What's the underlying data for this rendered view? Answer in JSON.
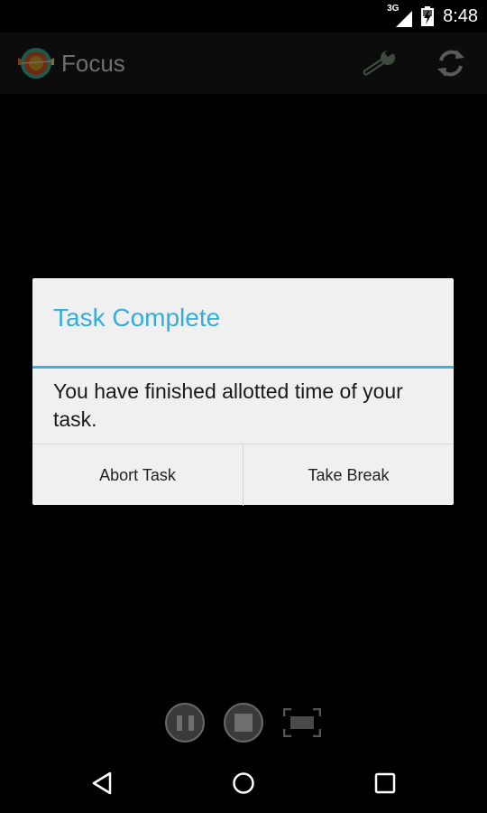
{
  "status_bar": {
    "network": "3G",
    "time": "8:48",
    "icons": [
      "signal-icon",
      "battery-charging-icon"
    ]
  },
  "action_bar": {
    "app_title": "Focus",
    "logo": "target-logo-icon",
    "actions": [
      {
        "name": "settings",
        "icon": "wrench-icon"
      },
      {
        "name": "refresh",
        "icon": "refresh-icon"
      }
    ]
  },
  "dialog": {
    "title": "Task Complete",
    "message": "You have finished allotted time of your task.",
    "buttons": [
      {
        "label": "Abort Task"
      },
      {
        "label": "Take Break"
      }
    ],
    "accent_color": "#33b5e5"
  },
  "controls": {
    "items": [
      {
        "name": "pause",
        "icon": "pause-icon"
      },
      {
        "name": "stop",
        "icon": "stop-icon"
      },
      {
        "name": "fullscreen",
        "icon": "fullscreen-icon"
      }
    ]
  },
  "nav_bar": {
    "items": [
      {
        "name": "back",
        "icon": "back-icon"
      },
      {
        "name": "home",
        "icon": "home-icon"
      },
      {
        "name": "recents",
        "icon": "recents-icon"
      }
    ]
  }
}
